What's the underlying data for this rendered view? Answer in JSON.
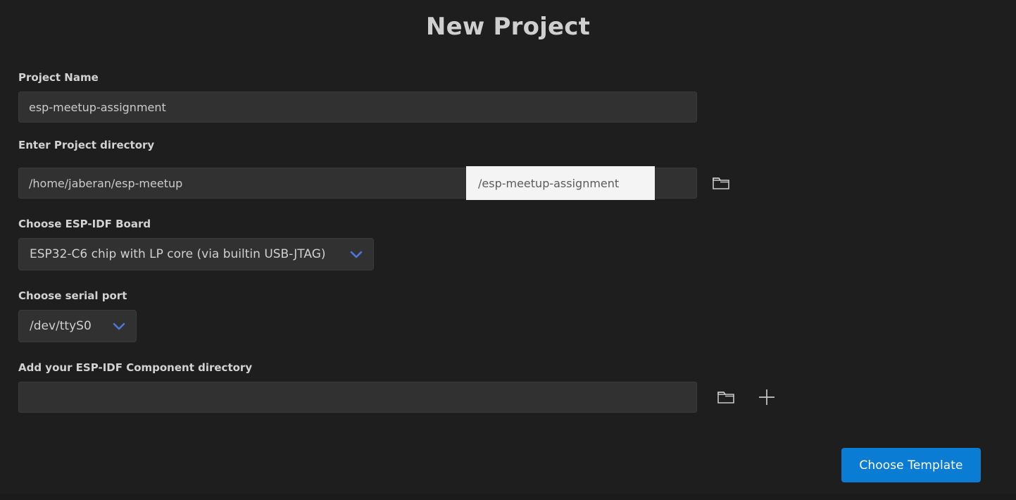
{
  "window": {
    "title": "New Project",
    "background_color": "#1e1e1e",
    "accent_color": "#0a7cd4",
    "chevron_color": "#4c78d8"
  },
  "form": {
    "project_name": {
      "label": "Project Name",
      "value": "esp-meetup-assignment",
      "placeholder": ""
    },
    "project_directory": {
      "label": "Enter Project directory",
      "value": "/home/jaberan/esp-meetup",
      "placeholder": "",
      "suggestion": "/esp-meetup-assignment",
      "browse_icon": "folder-icon"
    },
    "board": {
      "label": "Choose ESP-IDF Board",
      "selected": "ESP32-C6 chip with LP core (via builtin USB-JTAG)",
      "chevron_icon": "chevron-down-icon"
    },
    "serial_port": {
      "label": "Choose serial port",
      "selected": "/dev/ttyS0",
      "chevron_icon": "chevron-down-icon"
    },
    "component_directory": {
      "label": "Add your ESP-IDF Component directory",
      "value": "",
      "placeholder": "",
      "browse_icon": "folder-icon",
      "add_icon": "plus-icon"
    }
  },
  "actions": {
    "choose_template": "Choose Template"
  }
}
